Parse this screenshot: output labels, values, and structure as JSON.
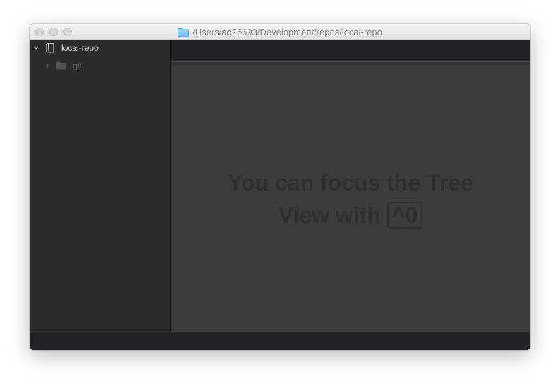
{
  "window": {
    "title": "/Users/ad26693/Development/repos/local-repo",
    "title_icon": "folder-icon"
  },
  "tree": {
    "root": {
      "label": "local-repo",
      "icon": "repo-icon",
      "expanded": true
    },
    "items": [
      {
        "label": ".git",
        "icon": "folder-icon",
        "expanded": false
      }
    ]
  },
  "main": {
    "background_tip_line1": "You can focus the Tree",
    "background_tip_line2_prefix": "View with",
    "background_tip_key": "^0"
  },
  "colors": {
    "folder_accent": "#7cc8f0",
    "sidebar_bg": "#2b2b2b",
    "editor_bg": "#3c3c3c"
  }
}
